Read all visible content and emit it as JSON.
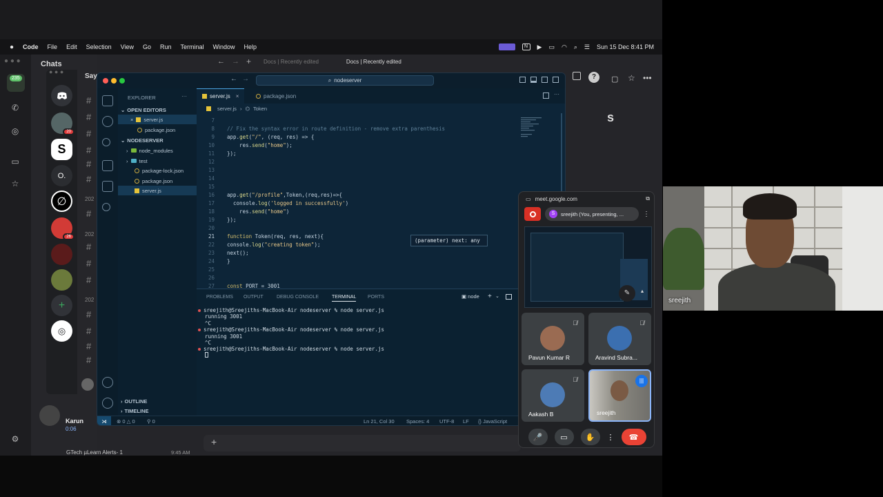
{
  "menubar": {
    "apple": "",
    "app": "Code",
    "items": [
      "File",
      "Edit",
      "Selection",
      "View",
      "Go",
      "Run",
      "Terminal",
      "Window",
      "Help"
    ],
    "datetime": "Sun 15 Dec  8:41 PM"
  },
  "chat_app": {
    "title": "Chats",
    "badge": "235",
    "year_labels": [
      "202",
      "202",
      "202"
    ],
    "contact_name": "Karun",
    "contact_meta": "0:06",
    "bottom_item": "GTech µLearn Alerts- 1",
    "bottom_time": "9:45 AM",
    "cropped_label": "Say"
  },
  "browser": {
    "tab1": "Docs | Recently edited",
    "tab2": "Docs | Recently edited",
    "right_partial": "s"
  },
  "discord": {
    "servers": [
      "",
      "",
      "S",
      "O.",
      "",
      "",
      "",
      "",
      "",
      "+",
      ""
    ],
    "badges": {
      "s2": "20",
      "s7": "26"
    }
  },
  "vscode": {
    "search": "nodeserver",
    "explorer_title": "EXPLORER",
    "open_editors": "OPEN EDITORS",
    "open_files": [
      "server.js",
      "package.json"
    ],
    "project": "NODESERVER",
    "tree": [
      "node_modules",
      "test",
      "package-lock.json",
      "package.json",
      "server.js"
    ],
    "outline": "OUTLINE",
    "timeline": "TIMELINE",
    "tabs": [
      "server.js",
      "package.json"
    ],
    "breadcrumb": [
      "server.js",
      "Token"
    ],
    "code_lines": [
      {
        "n": "7",
        "t": ""
      },
      {
        "n": "8",
        "t": "// Fix the syntax error in route definition - remove extra parenthesis"
      },
      {
        "n": "9",
        "t": "app.get(\"/\", (req, res) => {"
      },
      {
        "n": "10",
        "t": "    res.send(\"home\");"
      },
      {
        "n": "11",
        "t": "});"
      },
      {
        "n": "12",
        "t": ""
      },
      {
        "n": "13",
        "t": ""
      },
      {
        "n": "14",
        "t": ""
      },
      {
        "n": "15",
        "t": ""
      },
      {
        "n": "16",
        "t": "app.get(\"/profile\",Token,(req,res)=>{"
      },
      {
        "n": "17",
        "t": "  console.log('logged in successfully')"
      },
      {
        "n": "18",
        "t": "    res.send(\"home\")"
      },
      {
        "n": "19",
        "t": "});"
      },
      {
        "n": "20",
        "t": ""
      },
      {
        "n": "21",
        "t": "function Token(req, res, next){"
      },
      {
        "n": "22",
        "t": "console.log(\"creating token\");"
      },
      {
        "n": "23",
        "t": "next();"
      },
      {
        "n": "24",
        "t": "}"
      },
      {
        "n": "25",
        "t": ""
      },
      {
        "n": "26",
        "t": ""
      },
      {
        "n": "27",
        "t": "const PORT = 3001"
      }
    ],
    "hover": "(parameter) next: any",
    "panel_tabs": [
      "PROBLEMS",
      "OUTPUT",
      "DEBUG CONSOLE",
      "TERMINAL",
      "PORTS"
    ],
    "terminal_name": "node",
    "terminal_lines": [
      "sreejith@Sreejiths-MacBook-Air nodeserver % node server.js",
      "running 3001",
      "^C",
      "sreejith@Sreejiths-MacBook-Air nodeserver % node server.js",
      "running 3001",
      "^C",
      "sreejith@Sreejiths-MacBook-Air nodeserver % node server.js"
    ],
    "status": {
      "errors": "0",
      "warnings": "0",
      "ports": "0",
      "position": "Ln 21, Col 30",
      "spaces": "Spaces: 4",
      "encoding": "UTF-8",
      "eol": "LF",
      "language": "JavaScript"
    }
  },
  "meet": {
    "url": "meet.google.com",
    "presenting": "sreejith (You, presenting, ...",
    "presenter_initial": "S",
    "participants": [
      "Pavun Kumar R",
      "Aravind Subra...",
      "Aakash B",
      "sreejith"
    ]
  },
  "webcam": {
    "name": "sreejith"
  },
  "colors": {
    "accent": "#4aa3df",
    "meet_red": "#ea4335",
    "chat_badge": "#5fc26a"
  }
}
